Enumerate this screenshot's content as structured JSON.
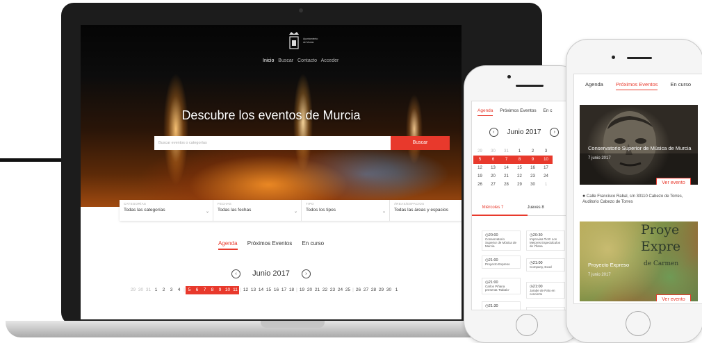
{
  "laptop": {
    "logo_text": [
      "Ayuntamiento",
      "de Murcia"
    ],
    "nav": [
      "Inicio",
      "Buscar",
      "Contacto",
      "Acceder"
    ],
    "hero_title": "Descubre los eventos de Murcia",
    "search_placeholder": "Buscar eventos o categorías",
    "search_button": "Buscar",
    "filters": [
      {
        "caption": "CATEGORÍAS",
        "value": "Todas las categorías"
      },
      {
        "caption": "FECHAS",
        "value": "Todas las fechas"
      },
      {
        "caption": "TIPO",
        "value": "Todos los tipos"
      },
      {
        "caption": "ÁREAS/ESPACIOS",
        "value": "Todas las áreas y espacios"
      }
    ],
    "tabs": [
      "Agenda",
      "Próximos Eventos",
      "En curso"
    ],
    "active_tab": "Agenda",
    "month": "Junio 2017",
    "dates": [
      "29",
      "30",
      "31",
      "1",
      "2",
      "3",
      "4",
      "5",
      "6",
      "7",
      "8",
      "9",
      "10",
      "11",
      "12",
      "13",
      "14",
      "15",
      "16",
      "17",
      "18",
      "19",
      "20",
      "21",
      "22",
      "23",
      "24",
      "25",
      "26",
      "27",
      "28",
      "29",
      "30",
      "1"
    ]
  },
  "phone1": {
    "tabs": [
      "Agenda",
      "Próximos Eventos",
      "En c"
    ],
    "month": "Junio 2017",
    "calendar_rows": [
      [
        "29",
        "30",
        "31",
        "1",
        "2",
        "3"
      ],
      [
        "5",
        "6",
        "7",
        "8",
        "9",
        "10"
      ],
      [
        "12",
        "13",
        "14",
        "15",
        "16",
        "17"
      ],
      [
        "19",
        "20",
        "21",
        "22",
        "23",
        "24"
      ],
      [
        "26",
        "27",
        "28",
        "29",
        "30",
        "1"
      ]
    ],
    "days": [
      "Miércoles 7",
      "Jueves 8"
    ],
    "events": [
      {
        "time": "20:00",
        "title": "Conservatorio Superior de Música de Murcia"
      },
      {
        "time": "20:30",
        "title": "Improvisa Tio!!! Los Mejores Espectáculos de Yllana"
      },
      {
        "time": "21:00",
        "title": "Proyecto Expreso"
      },
      {
        "time": "21:00",
        "title": "Company, Exod"
      },
      {
        "time": "21:00",
        "title": "Carlos Piñana presenta 'Rabalo'"
      },
      {
        "time": "21:00",
        "title": "Jarabe de Palo en concierto"
      },
      {
        "time": "21:30",
        "title": ""
      },
      {
        "time": "22:00",
        "title": ""
      }
    ]
  },
  "phone2": {
    "tabs": [
      "Agenda",
      "Próximos Eventos",
      "En curso"
    ],
    "card1": {
      "title": "Conservatorio Superior de Música de Murcia",
      "date": "7 junio 2017",
      "button": "Ver evento",
      "address": "Calle Francisco Rabal, s/n 30110 Cabezo de Torres, Auditorio Cabezo de Torres"
    },
    "card2": {
      "title": "Proyecto Expreso",
      "date": "7 junio 2017",
      "button": "Ver evento",
      "poster_text": [
        "Proye",
        "Expre",
        "de Carmen"
      ]
    }
  },
  "colors": {
    "accent": "#e8392c"
  }
}
